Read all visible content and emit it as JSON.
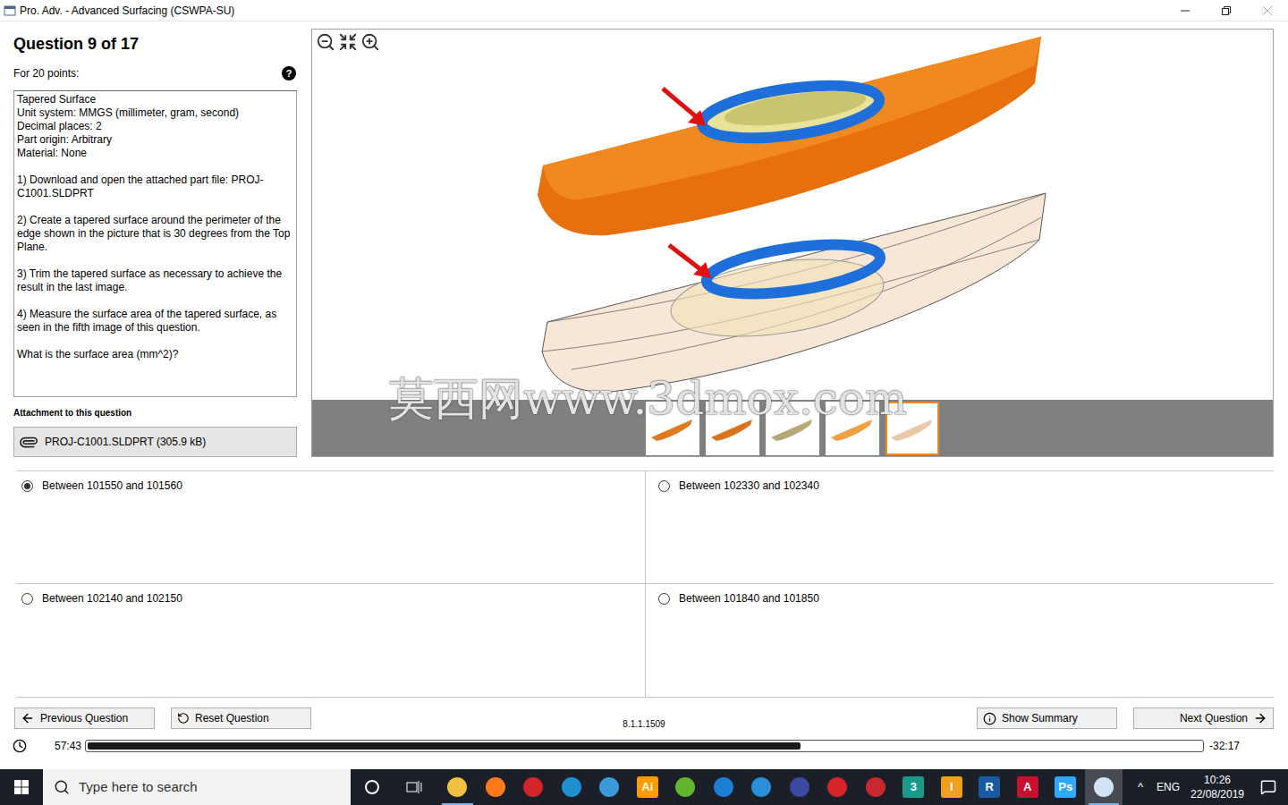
{
  "window": {
    "title": "Pro. Adv. - Advanced Surfacing (CSWPA-SU)"
  },
  "question": {
    "heading": "Question 9 of 17",
    "points": "For 20 points:",
    "help": "?",
    "paragraphs": [
      [
        "Tapered Surface",
        "Unit system: MMGS (millimeter, gram, second)",
        "Decimal places: 2",
        "Part origin: Arbitrary",
        "Material: None"
      ],
      [
        "1) Download and open the attached part file: PROJ-C1001.SLDPRT"
      ],
      [
        "2) Create a tapered surface around the perimeter of the edge shown in the picture that is 30 degrees from the Top Plane."
      ],
      [
        "3) Trim the tapered surface as necessary to achieve the result in the last image."
      ],
      [
        "4) Measure the surface area of the tapered surface, as seen in the fifth image of this question."
      ],
      [
        "What is the surface area (mm^2)?"
      ]
    ]
  },
  "attachment": {
    "label": "Attachment to this question",
    "file": "PROJ-C1001.SLDPRT (305.9 kB)"
  },
  "viewer": {
    "watermark": "莫西网www.3dmox.com",
    "thumbnails": [
      {
        "selected": false,
        "color": "#e07a1f"
      },
      {
        "selected": false,
        "color": "#d9731c"
      },
      {
        "selected": false,
        "color": "#b8a878"
      },
      {
        "selected": false,
        "color": "#f0a040"
      },
      {
        "selected": true,
        "color": "#e8c8a8"
      }
    ]
  },
  "answers": [
    {
      "text": "Between 101550 and 101560",
      "selected": true
    },
    {
      "text": "Between 102330 and 102340",
      "selected": false
    },
    {
      "text": "Between 102140 and 102150",
      "selected": false
    },
    {
      "text": "Between 101840 and 101850",
      "selected": false
    }
  ],
  "nav": {
    "previous": "Previous Question",
    "reset": "Reset Question",
    "version": "8.1.1.1509",
    "summary": "Show Summary",
    "next": "Next Question"
  },
  "timer": {
    "elapsed": "57:43",
    "remaining": "-32:17",
    "level": 0.64
  },
  "taskbar": {
    "search": "Type here to search",
    "apps": [
      {
        "glyph": "",
        "color": "#f0c040",
        "open": true,
        "selected": false
      },
      {
        "glyph": "",
        "color": "#ff7a1a",
        "open": false,
        "selected": false
      },
      {
        "glyph": "",
        "color": "#d4242a",
        "open": false,
        "selected": false
      },
      {
        "glyph": "",
        "color": "#1e90d0",
        "open": false,
        "selected": false
      },
      {
        "glyph": "",
        "color": "#3a9ad9",
        "open": false,
        "selected": false
      },
      {
        "glyph": "Ai",
        "color": "#ff9a00",
        "open": false,
        "selected": false
      },
      {
        "glyph": "",
        "color": "#66b32e",
        "open": false,
        "selected": false
      },
      {
        "glyph": "",
        "color": "#1d7fd4",
        "open": false,
        "selected": false
      },
      {
        "glyph": "",
        "color": "#2a8fd8",
        "open": false,
        "selected": false
      },
      {
        "glyph": "",
        "color": "#3a4aa0",
        "open": false,
        "selected": false
      },
      {
        "glyph": "",
        "color": "#d4242a",
        "open": false,
        "selected": false
      },
      {
        "glyph": "",
        "color": "#c8282e",
        "open": false,
        "selected": false
      },
      {
        "glyph": "3",
        "color": "#1a9a8a",
        "open": false,
        "selected": false
      },
      {
        "glyph": "I",
        "color": "#f0a020",
        "open": false,
        "selected": false
      },
      {
        "glyph": "R",
        "color": "#1a5a9e",
        "open": false,
        "selected": false
      },
      {
        "glyph": "A",
        "color": "#c8102e",
        "open": false,
        "selected": false
      },
      {
        "glyph": "Ps",
        "color": "#31a8ff",
        "open": false,
        "selected": false
      },
      {
        "glyph": "",
        "color": "#cfe3f5",
        "open": true,
        "selected": true
      }
    ],
    "tray_chevron": "^",
    "language": "ENG",
    "time": "10:26",
    "date": "22/08/2019"
  }
}
